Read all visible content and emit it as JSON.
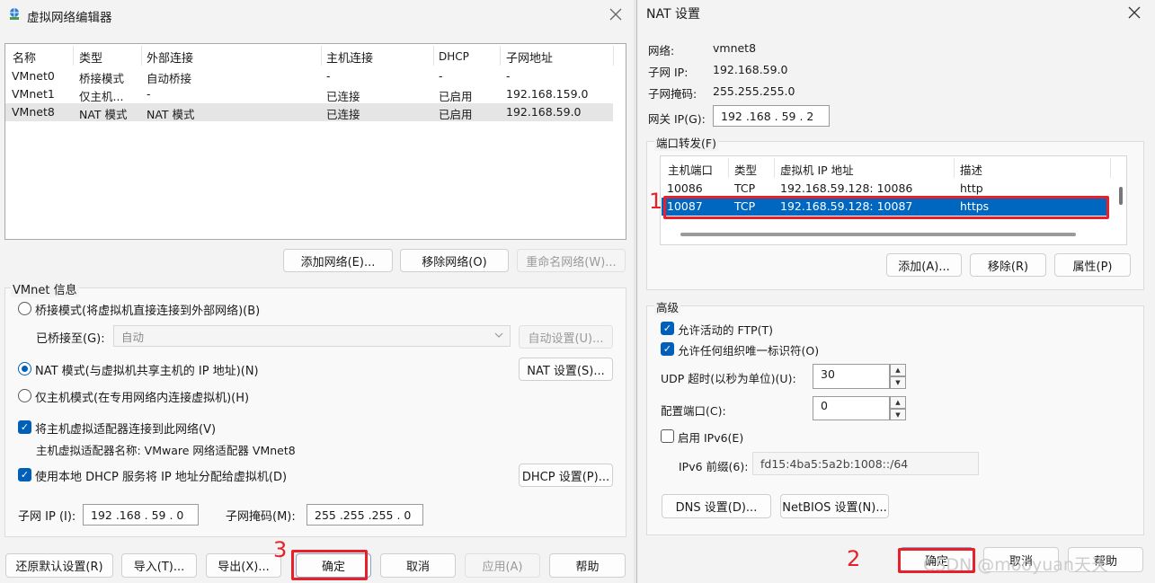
{
  "left": {
    "title": "虚拟网络编辑器",
    "table": {
      "headers": [
        "名称",
        "类型",
        "外部连接",
        "主机连接",
        "DHCP",
        "子网地址"
      ],
      "rows": [
        [
          "VMnet0",
          "桥接模式",
          "自动桥接",
          "-",
          "-",
          "-"
        ],
        [
          "VMnet1",
          "仅主机...",
          "-",
          "已连接",
          "已启用",
          "192.168.159.0"
        ],
        [
          "VMnet8",
          "NAT 模式",
          "NAT 模式",
          "已连接",
          "已启用",
          "192.168.59.0"
        ]
      ]
    },
    "buttons": {
      "add_network": "添加网络(E)...",
      "remove_network": "移除网络(O)",
      "rename_network": "重命名网络(W)...",
      "auto_settings": "自动设置(U)...",
      "nat_settings": "NAT 设置(S)...",
      "dhcp_settings": "DHCP 设置(P)...",
      "restore": "还原默认设置(R)",
      "import": "导入(T)...",
      "export": "导出(X)...",
      "ok": "确定",
      "cancel": "取消",
      "apply": "应用(A)",
      "help": "帮助"
    },
    "vmnet_info": {
      "legend": "VMnet 信息",
      "bridged": "桥接模式(将虚拟机直接连接到外部网络)(B)",
      "bridged_to_label": "已桥接至(G):",
      "bridged_to_value": "自动",
      "nat": "NAT 模式(与虚拟机共享主机的 IP 地址)(N)",
      "host_only": "仅主机模式(在专用网络内连接虚拟机)(H)",
      "connect_adapter": "将主机虚拟适配器连接到此网络(V)",
      "adapter_name": "主机虚拟适配器名称: VMware 网络适配器 VMnet8",
      "use_dhcp": "使用本地 DHCP 服务将 IP 地址分配给虚拟机(D)",
      "subnet_ip_label": "子网 IP (I):",
      "subnet_ip_value": "192 .168 . 59 . 0",
      "subnet_mask_label": "子网掩码(M):",
      "subnet_mask_value": "255 .255 .255 . 0"
    },
    "annotation": "3"
  },
  "right": {
    "title": "NAT 设置",
    "network_label": "网络:",
    "network_value": "vmnet8",
    "subnet_ip_label": "子网 IP:",
    "subnet_ip_value": "192.168.59.0",
    "subnet_mask_label": "子网掩码:",
    "subnet_mask_value": "255.255.255.0",
    "gateway_label": "网关 IP(G):",
    "gateway_value": "192 .168 . 59 . 2",
    "port_forward_legend": "端口转发(F)",
    "pf_table": {
      "headers": [
        "主机端口",
        "类型",
        "虚拟机 IP 地址",
        "描述"
      ],
      "rows": [
        [
          "10086",
          "TCP",
          "192.168.59.128: 10086",
          "http"
        ],
        [
          "10087",
          "TCP",
          "192.168.59.128: 10087",
          "https"
        ]
      ]
    },
    "pf_buttons": {
      "add": "添加(A)...",
      "remove": "移除(R)",
      "properties": "属性(P)"
    },
    "advanced_legend": "高级",
    "allow_ftp": "允许活动的 FTP(T)",
    "allow_oui": "允许任何组织唯一标识符(O)",
    "udp_timeout_label": "UDP 超时(以秒为单位)(U):",
    "udp_timeout_value": "30",
    "config_port_label": "配置端口(C):",
    "config_port_value": "0",
    "enable_ipv6": "启用 IPv6(E)",
    "ipv6_prefix_label": "IPv6 前缀(6):",
    "ipv6_prefix_value": "fd15:4ba5:5a2b:1008::/64",
    "dns_settings": "DNS 设置(D)...",
    "netbios_settings": "NetBIOS 设置(N)...",
    "ok": "确定",
    "cancel": "取消",
    "help": "帮助",
    "annotation_1": "1",
    "annotation_2": "2",
    "watermark": "CSDN @mooyuan天天"
  },
  "colors": {
    "accent": "#005fb8",
    "selection": "#0067c0",
    "annotation": "#e8202a"
  },
  "icons": {
    "app": "network-globe-icon",
    "close": "close-icon",
    "dropdown": "chevron-down-icon"
  }
}
